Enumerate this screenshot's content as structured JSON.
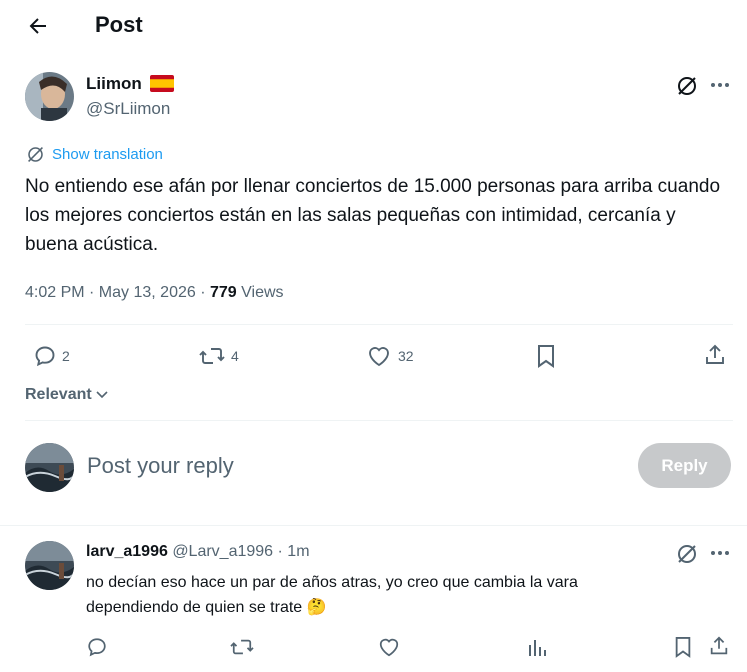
{
  "header": {
    "title": "Post"
  },
  "post": {
    "author_name": "Liimon",
    "author_flag": "🇪🇸",
    "author_handle": "@SrLiimon",
    "show_translation": "Show translation",
    "text": "No entiendo ese afán por llenar conciertos de 15.000 personas para arriba cuando los mejores conciertos están en las salas pequeñas con intimidad, cercanía y buena acústica.",
    "timestamp": "4:02 PM · May 13, 2026 · ",
    "views_count": "779",
    "views_label": " Views",
    "replies": "2",
    "reposts": "4",
    "likes": "32"
  },
  "sort": {
    "label": "Relevant"
  },
  "composer": {
    "placeholder": "Post your reply",
    "reply_button": "Reply"
  },
  "reply": {
    "author_name": "larv_a1996",
    "author_handle": "@Larv_a1996",
    "time": "· 1m",
    "text_line1": "no decían eso hace un par de años atras, yo creo que cambia la vara",
    "text_line2": "dependiendo de quien se trate 🤔"
  },
  "colors": {
    "accent": "#1d9bf0",
    "text": "#0f1419",
    "muted": "#536471",
    "button_disabled": "#c7c9cb"
  }
}
